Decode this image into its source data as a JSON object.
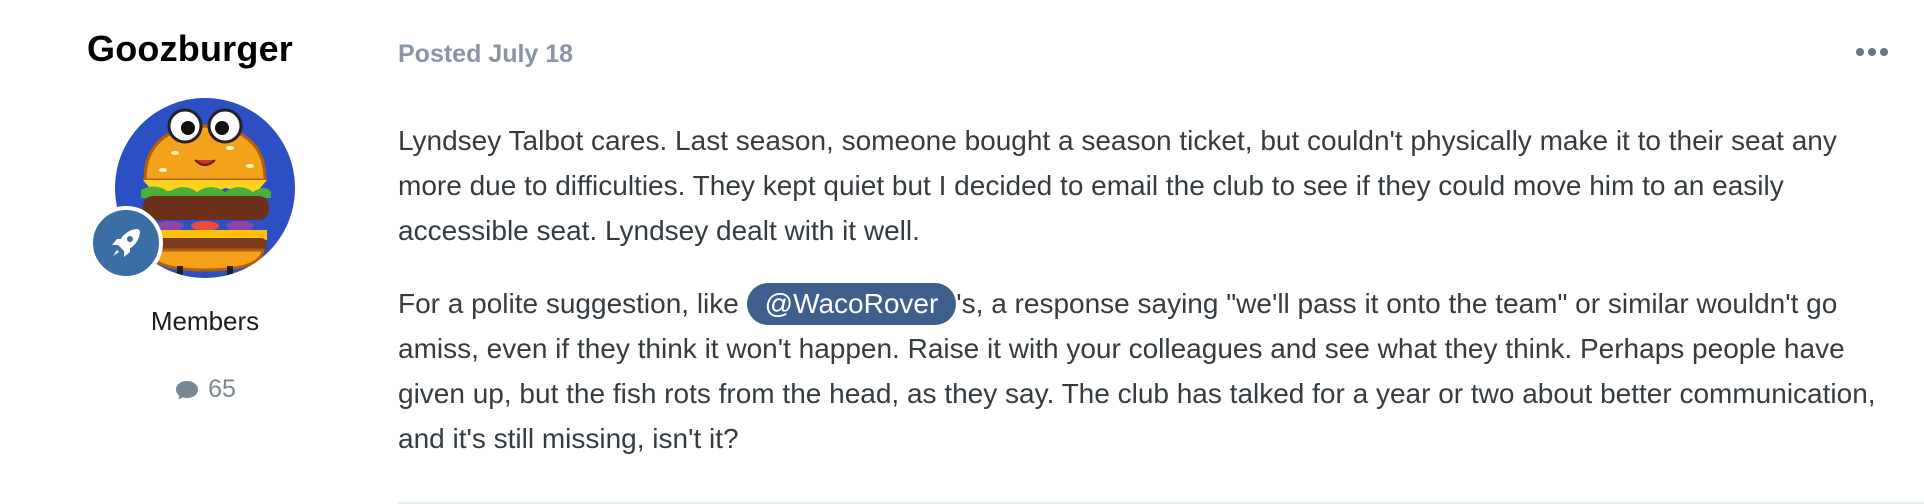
{
  "author": {
    "username": "Goozburger",
    "group": "Members",
    "post_count": "65",
    "avatar_icon": "burger-avatar-icon",
    "rank_icon": "rocket-icon"
  },
  "post": {
    "posted_label": "Posted",
    "posted_date": "July 18",
    "paragraph1": "Lyndsey Talbot cares. Last season, someone bought a season ticket, but couldn't physically make it to their seat any more due to difficulties. They kept quiet but I decided to email the club to see if they could move him to an easily accessible seat. Lyndsey dealt with it well.",
    "paragraph2_before": "For a polite suggestion, like ",
    "mention": "@WacoRover",
    "paragraph2_after": "'s, a response saying \"we'll pass it onto the team\" or similar wouldn't go amiss, even if they think it won't happen. Raise it with your colleagues and see what they think. Perhaps people have given up, but the fish rots from the head, as they say. The club has talked for a year or two about better communication, and it's still missing, isn't it?"
  },
  "colors": {
    "mention_bg": "#3f5f8c",
    "rank_badge": "#3b6ea5",
    "avatar_bg": "#2d4fc4",
    "meta_text": "#8a95a3"
  }
}
